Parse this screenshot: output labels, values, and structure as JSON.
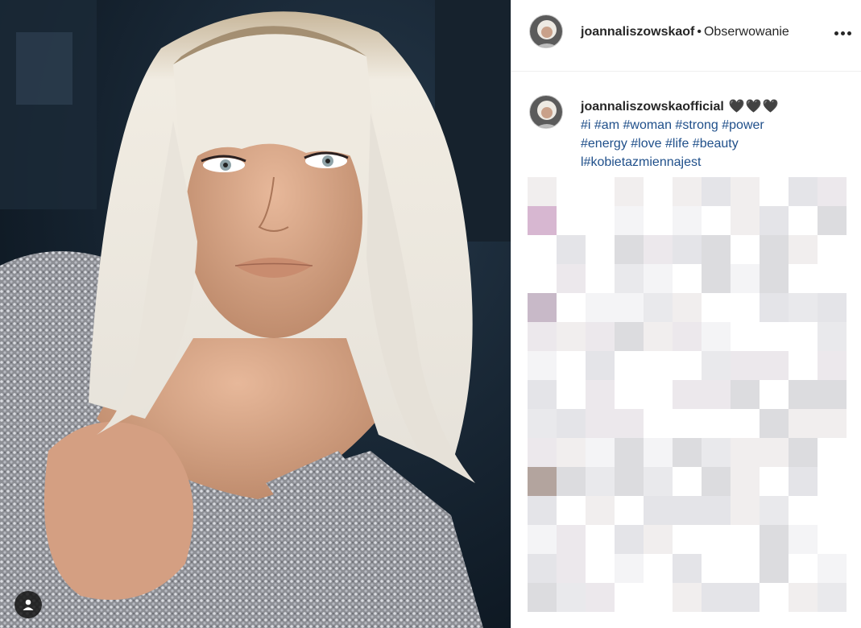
{
  "post": {
    "header": {
      "username": "joannaliszowskaof",
      "separator": "•",
      "follow_status": "Obserwowanie",
      "more_icon": "ellipsis-icon"
    },
    "caption": {
      "username": "joannaliszowskaofficial",
      "hearts": "🖤🖤🖤",
      "hashtags_line1": [
        "#i",
        "#am",
        "#woman",
        "#strong",
        "#power"
      ],
      "hashtags_line2": [
        "#energy",
        "#love",
        "#life",
        "#beauty"
      ],
      "hashtags_line3": [
        "l#kobietazmiennajest"
      ]
    },
    "photo": {
      "tag_icon": "user-tag-icon"
    }
  },
  "colors": {
    "hashtag": "#1f4f8a",
    "text": "#262626",
    "border": "#efefef"
  }
}
